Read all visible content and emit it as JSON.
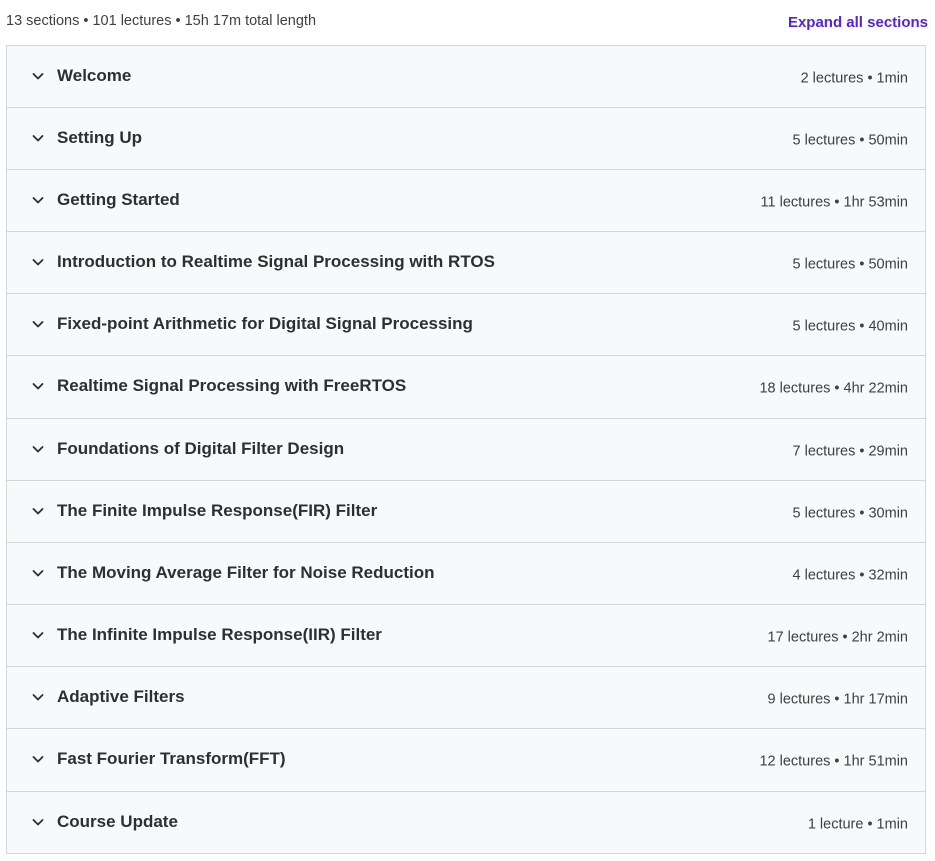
{
  "curriculum": {
    "summary": "13 sections • 101 lectures • 15h 17m total length",
    "expand_all_label": "Expand all sections",
    "accent_color": "#5624d0",
    "chevron_icon": "chevron-down-icon",
    "sections": [
      {
        "title": "Welcome",
        "meta": "2 lectures • 1min"
      },
      {
        "title": "Setting Up",
        "meta": "5 lectures • 50min"
      },
      {
        "title": "Getting Started",
        "meta": "11 lectures • 1hr 53min"
      },
      {
        "title": "Introduction to Realtime Signal Processing with RTOS",
        "meta": "5 lectures • 50min"
      },
      {
        "title": "Fixed-point Arithmetic for Digital Signal Processing",
        "meta": "5 lectures • 40min"
      },
      {
        "title": "Realtime Signal Processing with FreeRTOS",
        "meta": "18 lectures • 4hr 22min"
      },
      {
        "title": "Foundations of Digital Filter Design",
        "meta": "7 lectures • 29min"
      },
      {
        "title": "The Finite Impulse Response(FIR) Filter",
        "meta": "5 lectures • 30min"
      },
      {
        "title": "The Moving Average Filter for Noise Reduction",
        "meta": "4 lectures • 32min"
      },
      {
        "title": "The Infinite Impulse Response(IIR) Filter",
        "meta": "17 lectures • 2hr 2min"
      },
      {
        "title": "Adaptive Filters",
        "meta": "9 lectures • 1hr 17min"
      },
      {
        "title": "Fast Fourier Transform(FFT)",
        "meta": "12 lectures • 1hr 51min"
      },
      {
        "title": "Course Update",
        "meta": "1 lecture • 1min"
      }
    ]
  }
}
